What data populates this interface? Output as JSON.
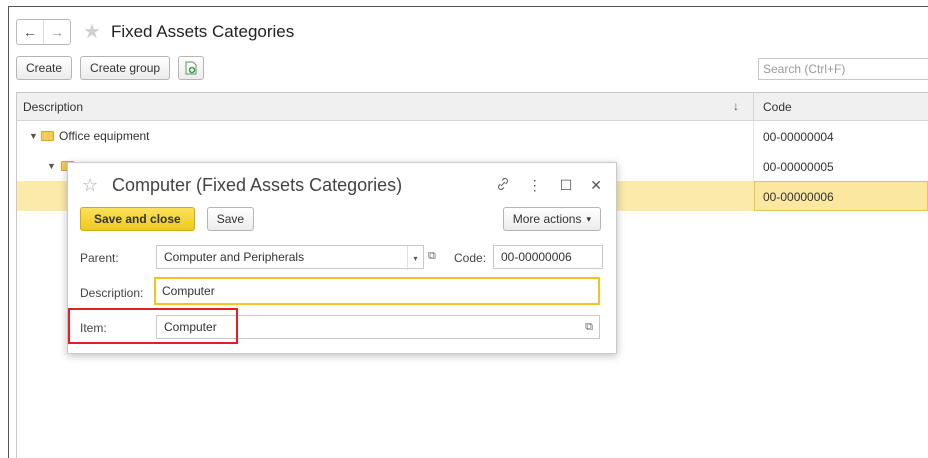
{
  "header": {
    "back_icon": "←",
    "forward_icon": "→",
    "star_icon": "★",
    "title": "Fixed Assets Categories"
  },
  "toolbar": {
    "create_label": "Create",
    "create_group_label": "Create group",
    "add_icon": "add-document-icon"
  },
  "search": {
    "placeholder": "Search (Ctrl+F)"
  },
  "grid": {
    "columns": {
      "description": "Description",
      "sort_arrow": "↓",
      "code": "Code"
    },
    "rows": [
      {
        "description": "Office equipment",
        "code": "00-00000004"
      },
      {
        "description": "",
        "code": "00-00000005"
      },
      {
        "description": "",
        "code": "00-00000006"
      }
    ]
  },
  "dialog": {
    "star_icon": "☆",
    "title": "Computer (Fixed Assets Categories)",
    "link_icon": "🔗",
    "menu_icon": "⋮",
    "maximize_icon": "☐",
    "close_icon": "✕",
    "save_close_label": "Save and close",
    "save_label": "Save",
    "more_actions_label": "More actions",
    "more_arrow": "▾",
    "parent_label": "Parent:",
    "parent_value": "Computer and Peripherals",
    "code_label": "Code:",
    "code_value": "00-00000006",
    "description_label": "Description:",
    "description_value": "Computer",
    "item_label": "Item:",
    "item_value": "Computer",
    "drop_arrow": "▾",
    "open_icon": "⧉"
  },
  "colors": {
    "accent_yellow": "#f5d32e",
    "selected_row": "#fbeaa9",
    "highlight_red": "#e31e24"
  }
}
